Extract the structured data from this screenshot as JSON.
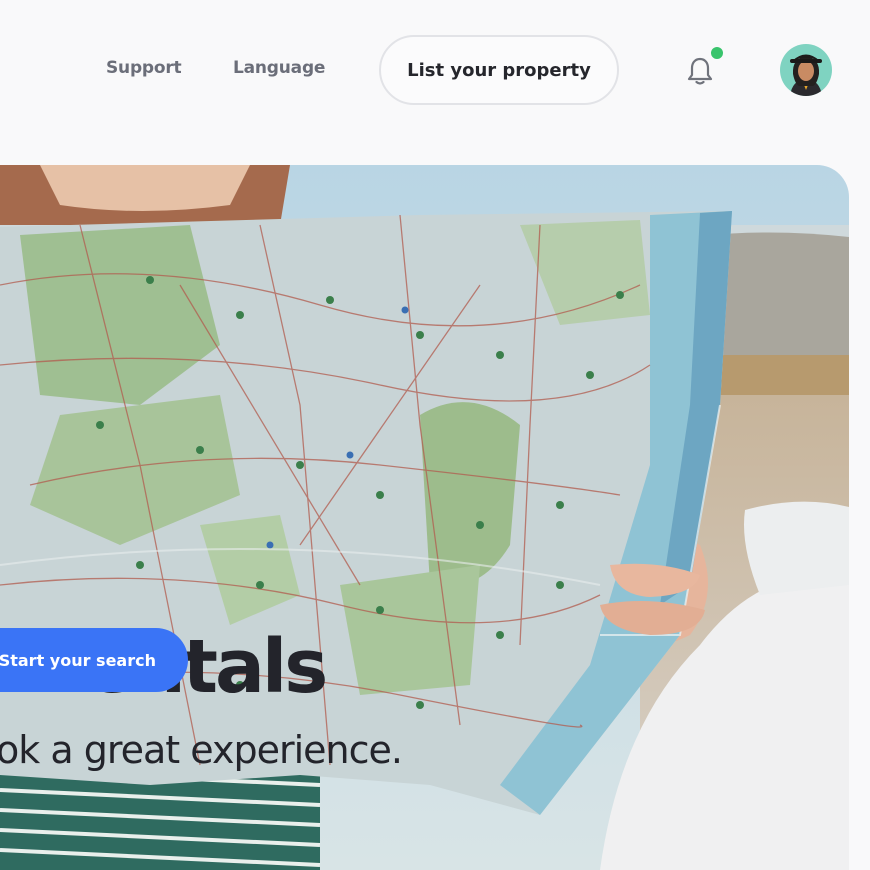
{
  "header": {
    "nav": [
      {
        "label": "Support"
      },
      {
        "label": "Language"
      }
    ],
    "list_property_label": "List your property",
    "notification_icon": "bell-icon",
    "has_notification": true,
    "accent_notification_color": "#39c46c"
  },
  "hero": {
    "title": "r rentals",
    "subtitle": "ok a great experience.",
    "cta_label": "Start your search",
    "cta_color": "#3a74f6"
  }
}
